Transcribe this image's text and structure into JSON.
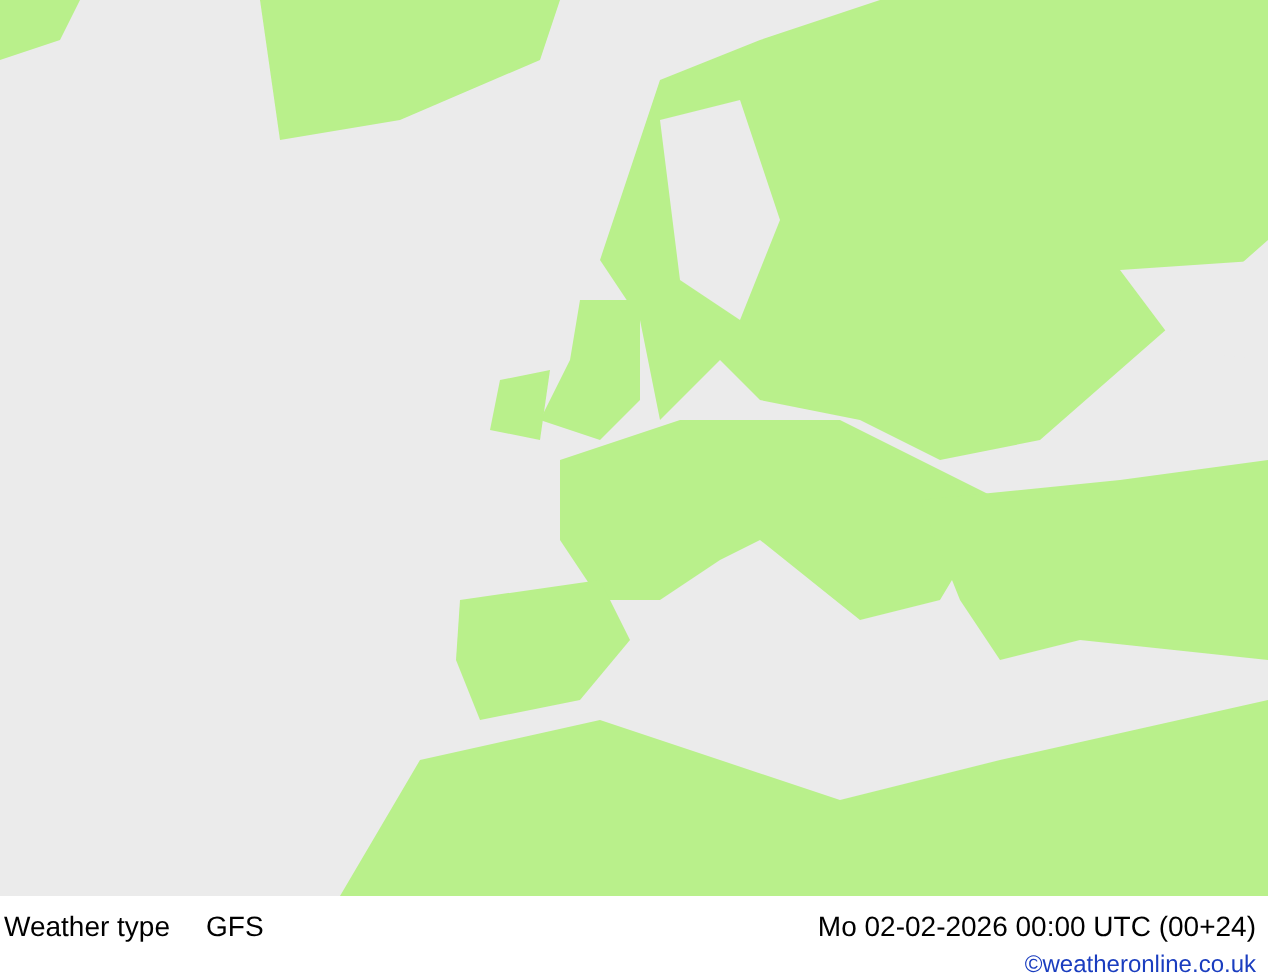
{
  "footer": {
    "title": "Weather type",
    "model": "GFS",
    "valid_time": "Mo 02-02-2026 00:00 UTC (00+24)",
    "credit": "©weatheronline.co.uk"
  }
}
